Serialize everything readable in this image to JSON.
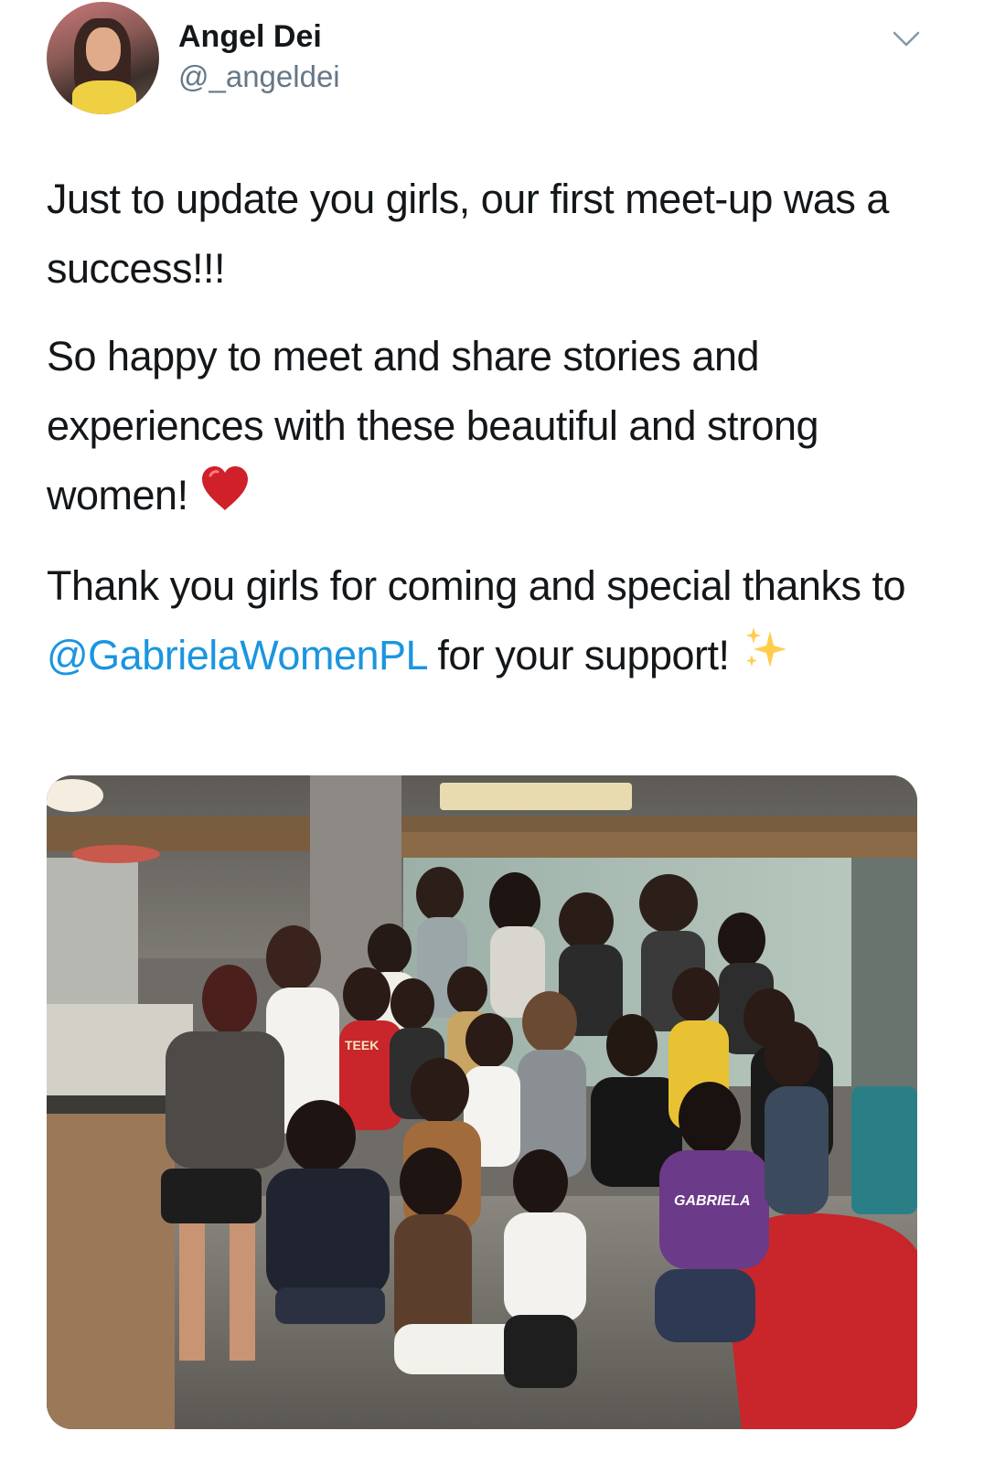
{
  "tweet": {
    "author": {
      "display_name": "Angel Dei",
      "handle": "@_angeldei",
      "avatar_icon": "profile-photo"
    },
    "menu_icon": "chevron-down-icon",
    "paragraphs": {
      "p1": "Just to update you girls, our first meet-up was a success!!!",
      "p2_text": "So happy to meet and share stories and experiences with these beautiful and strong women!",
      "p2_emoji": "red-heart",
      "p3_before": "Thank you girls for coming and special thanks to ",
      "p3_mention": "@GabrielaWomenPL",
      "p3_after": " for your support!",
      "p3_emoji": "sparkles"
    },
    "media": {
      "kind": "group-photo",
      "shirt_text_1": "GABRIELA",
      "shirt_text_2": "TEEK"
    },
    "colors": {
      "text": "#14171a",
      "secondary": "#657786",
      "link": "#1b95e0",
      "heart": "#dd2e44",
      "sparkle": "#ffcc4d"
    }
  }
}
